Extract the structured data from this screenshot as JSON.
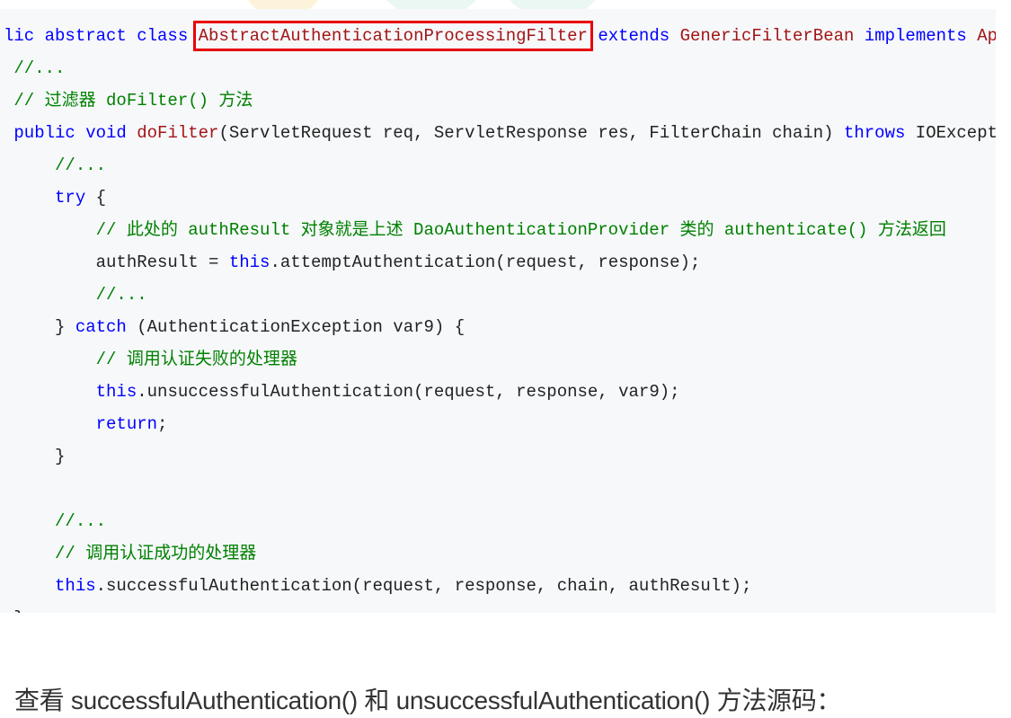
{
  "code": {
    "lines": [
      [
        [
          "kw",
          "lic abstract class"
        ],
        [
          "tx",
          " "
        ],
        [
          "cls-hl",
          "AbstractAuthenticationProcessingFilter"
        ],
        [
          "tx",
          " "
        ],
        [
          "kw",
          "extends"
        ],
        [
          "tx",
          " "
        ],
        [
          "cls",
          "GenericFilterBean"
        ],
        [
          "tx",
          " "
        ],
        [
          "kw",
          "implements"
        ],
        [
          "tx",
          " "
        ],
        [
          "cls",
          "Ap"
        ]
      ],
      [
        [
          "cm",
          " //..."
        ]
      ],
      [
        [
          "cm",
          " // 过滤器 doFilter() 方法"
        ]
      ],
      [
        [
          "kw",
          " public void"
        ],
        [
          "tx",
          " "
        ],
        [
          "cls",
          "doFilter"
        ],
        [
          "tx",
          "(ServletRequest req, ServletResponse res, FilterChain chain) "
        ],
        [
          "kw",
          "throws"
        ],
        [
          "tx",
          " IOExcept"
        ]
      ],
      [
        [
          "cm",
          "     //..."
        ]
      ],
      [
        [
          "tx",
          "     "
        ],
        [
          "kw",
          "try"
        ],
        [
          "tx",
          " {"
        ]
      ],
      [
        [
          "cm",
          "         // 此处的 authResult 对象就是上述 DaoAuthenticationProvider 类的 authenticate() 方法返回"
        ]
      ],
      [
        [
          "tx",
          "         authResult = "
        ],
        [
          "kw",
          "this"
        ],
        [
          "tx",
          ".attemptAuthentication(request, response);"
        ]
      ],
      [
        [
          "cm",
          "         //..."
        ]
      ],
      [
        [
          "tx",
          "     } "
        ],
        [
          "kw",
          "catch"
        ],
        [
          "tx",
          " (AuthenticationException var9) {"
        ]
      ],
      [
        [
          "cm",
          "         // 调用认证失败的处理器"
        ]
      ],
      [
        [
          "tx",
          "         "
        ],
        [
          "kw",
          "this"
        ],
        [
          "tx",
          ".unsuccessfulAuthentication(request, response, var9);"
        ]
      ],
      [
        [
          "tx",
          "         "
        ],
        [
          "kw",
          "return"
        ],
        [
          "tx",
          ";"
        ]
      ],
      [
        [
          "tx",
          "     }"
        ]
      ],
      [
        [
          "tx",
          ""
        ]
      ],
      [
        [
          "cm",
          "     //..."
        ]
      ],
      [
        [
          "cm",
          "     // 调用认证成功的处理器"
        ]
      ],
      [
        [
          "tx",
          "     "
        ],
        [
          "kw",
          "this"
        ],
        [
          "tx",
          ".successfulAuthentication(request, response, chain, authResult);"
        ]
      ],
      [
        [
          "tx",
          " }"
        ]
      ]
    ]
  },
  "caption": "查看 successfulAuthentication() 和 unsuccessfulAuthentication() 方法源码：",
  "colors": {
    "keyword": "#0000ff",
    "class": "#a31515",
    "comment": "#008000",
    "highlight": "#e8000b",
    "code_bg": "#f6f8fa"
  }
}
